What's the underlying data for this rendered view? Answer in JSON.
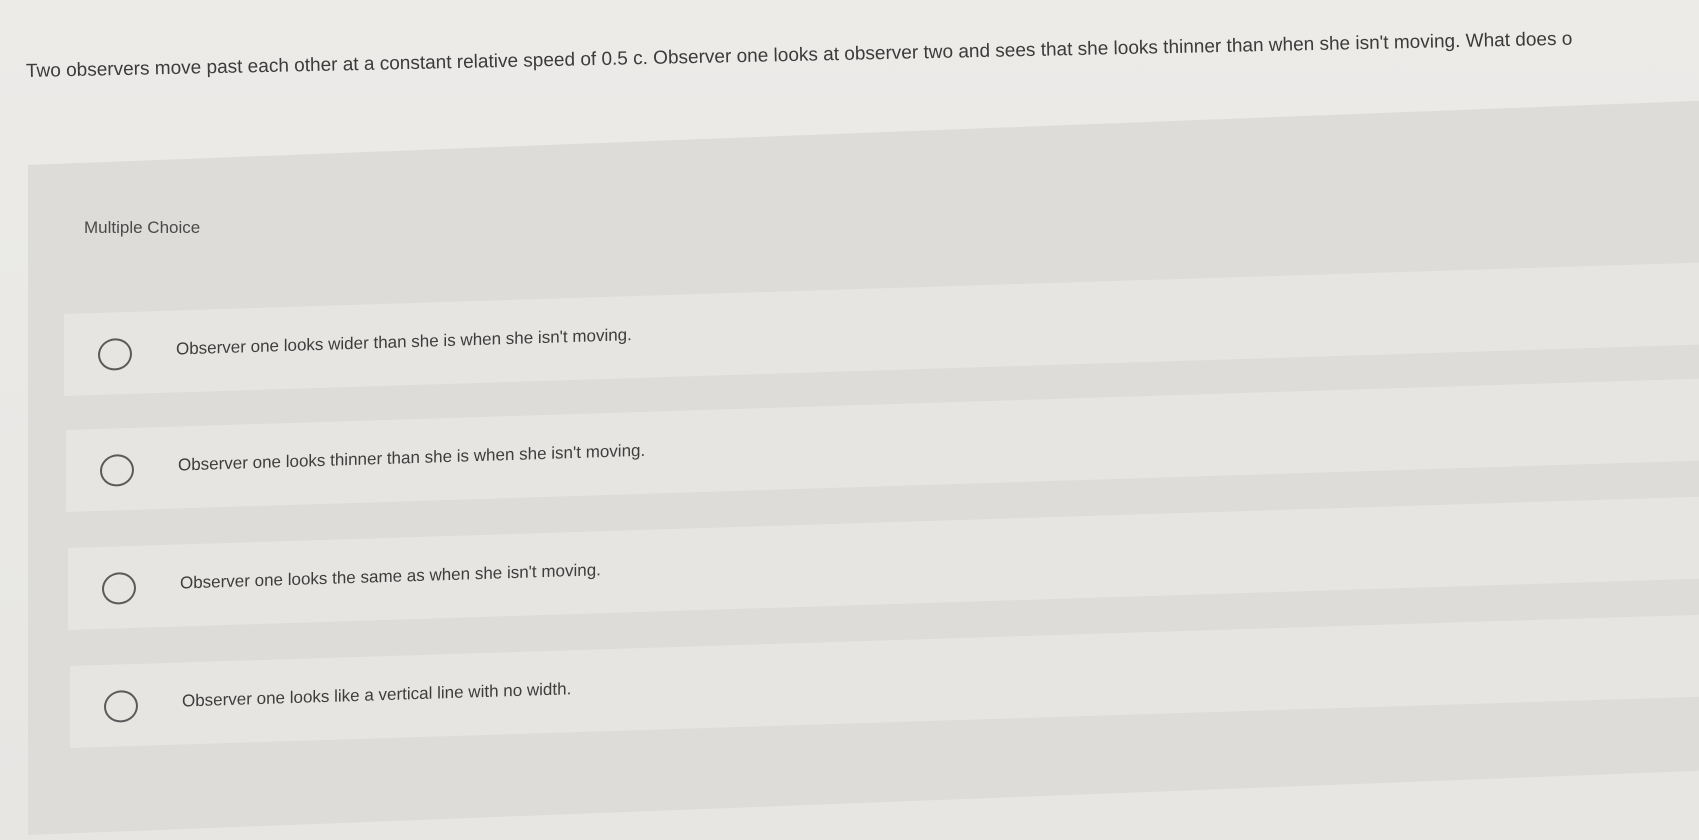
{
  "question": {
    "text": "Two observers move past each other at a constant relative speed of 0.5 c. Observer one looks at observer two and sees that she looks thinner than when she isn't moving. What does o"
  },
  "multiple_choice": {
    "label": "Multiple Choice",
    "options": [
      {
        "text": "Observer one looks wider than she is when she isn't moving."
      },
      {
        "text": "Observer one looks thinner than she is when she isn't moving."
      },
      {
        "text": "Observer one looks the same as when she isn't moving."
      },
      {
        "text": "Observer one looks like a vertical line with no width."
      }
    ]
  }
}
